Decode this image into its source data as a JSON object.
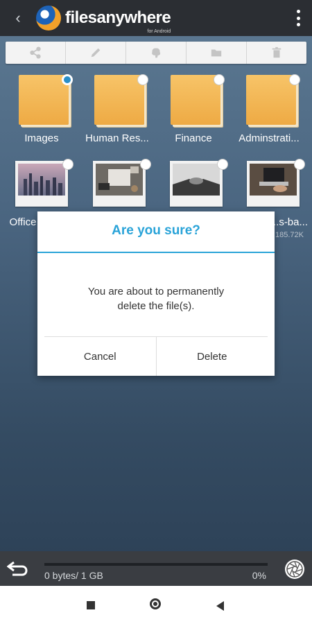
{
  "header": {
    "back_icon": "chevron-left-icon",
    "logo_text": "filesanywhere",
    "logo_subtext": "for Android",
    "menu_icon": "kebab-menu-icon"
  },
  "toolbar": {
    "tools": [
      "share-icon",
      "edit-pencil-icon",
      "brain-icon",
      "move-folder-icon",
      "trash-icon"
    ]
  },
  "files": [
    {
      "name": "Images",
      "type": "folder",
      "selected": true
    },
    {
      "name": "Human Res...",
      "type": "folder",
      "selected": false
    },
    {
      "name": "Finance",
      "type": "folder",
      "selected": false
    },
    {
      "name": "Adminstrati...",
      "type": "folder",
      "selected": false
    },
    {
      "name": "Office",
      "type": "image",
      "selected": false
    },
    {
      "name": "",
      "type": "image",
      "selected": false
    },
    {
      "name": "",
      "type": "image",
      "selected": false
    },
    {
      "name": "...s-ba...",
      "type": "image",
      "selected": false,
      "size": "185.72K"
    }
  ],
  "dialog": {
    "title": "Are you sure?",
    "message_line1": "You are about to permanently",
    "message_line2": "delete the file(s).",
    "cancel_label": "Cancel",
    "delete_label": "Delete"
  },
  "storage": {
    "used_label": "0 bytes/ 1 GB",
    "percent_label": "0%",
    "fraction": 0
  },
  "colors": {
    "accent": "#29a3d8",
    "folder": "#f2b552",
    "header": "#2b2e33"
  }
}
